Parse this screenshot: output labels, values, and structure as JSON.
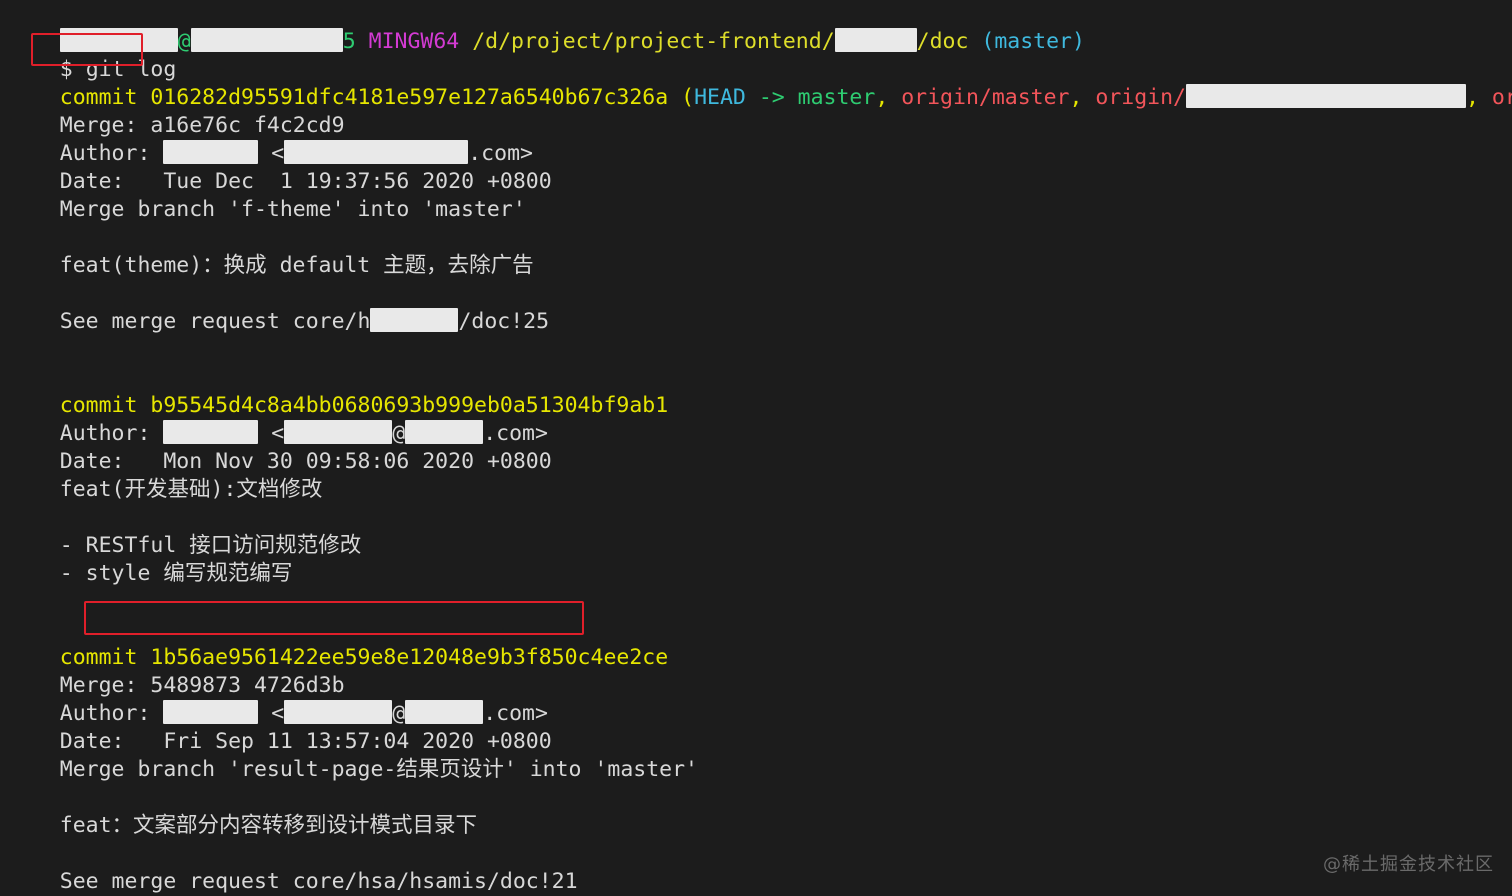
{
  "terminal": {
    "colors": {
      "background": "#1c1c1c",
      "foreground": "#d8d8d8",
      "yellow": "#e6e600",
      "green": "#2ecc71",
      "magenta": "#d33bd3",
      "cyan": "#3fb9de",
      "red": "#f2555a",
      "path_yellow": "#dede2a",
      "annotation_red": "#e01f2a",
      "redaction": "#e9e9e9"
    },
    "prompt": {
      "user_redacted": "",
      "at": "@",
      "host_redacted": "",
      "suffix": "5",
      "shell": "MINGW64",
      "path_prefix": "/d/project/project-frontend/",
      "path_redacted": "",
      "path_suffix": "/doc",
      "branch": "(master)"
    },
    "command_line": {
      "dollar": "$",
      "command": "git log"
    },
    "commits": [
      {
        "label": "commit",
        "hash": "016282d95591dfc4181e597e127a6540b67c326a",
        "refs_open": "(",
        "head": "HEAD",
        "arrow": "->",
        "head_branch": "master",
        "comma1": ", ",
        "ref_origin_master": "origin/master",
        "comma2": ", ",
        "ref_origin_prefix": "origin/",
        "comma3": ", ",
        "ref_origin_head": "origin/HEAD",
        "refs_close": ")",
        "merge_label": "Merge:",
        "merge_parents": "a16e76c f4c2cd9",
        "author_label": "Author:",
        "author_email_suffix": ".com>",
        "date_label": "Date:",
        "date_value": "Tue Dec  1 19:37:56 2020 +0800",
        "body": [
          "Merge branch 'f-theme' into 'master'",
          "feat(theme)：换成 default 主题，去除广告",
          "See merge request core/h"
        ],
        "merge_request_suffix": "/doc!25"
      },
      {
        "label": "commit",
        "hash": "b95545d4c8a4bb0680693b999eb0a51304bf9ab1",
        "author_label": "Author:",
        "author_email_suffix": ".com>",
        "date_label": "Date:",
        "date_value": "Mon Nov 30 09:58:06 2020 +0800",
        "body": [
          "feat(开发基础):文档修改",
          "- RESTful 接口访问规范修改",
          "- style 编写规范编写"
        ]
      },
      {
        "label": "commit",
        "hash": "1b56ae9561422ee59e8e12048e9b3f850c4ee2ce",
        "merge_label": "Merge:",
        "merge_parents": "5489873 4726d3b",
        "author_label": "Author:",
        "author_email_suffix": ".com>",
        "date_label": "Date:",
        "date_value": "Fri Sep 11 13:57:04 2020 +0800",
        "body": [
          "Merge branch 'result-page-结果页设计' into 'master'",
          "feat：文案部分内容转移到设计模式目录下",
          "See merge request core/hsa/hsamis/doc!21"
        ]
      }
    ],
    "annotations": [
      {
        "name": "git-log-highlight",
        "target": "git log"
      },
      {
        "name": "commit-hash-highlight",
        "target": "1b56ae9561422ee59e8e12048e9b3f850c4ee2ce"
      }
    ],
    "watermark": "@稀土掘金技术社区"
  }
}
